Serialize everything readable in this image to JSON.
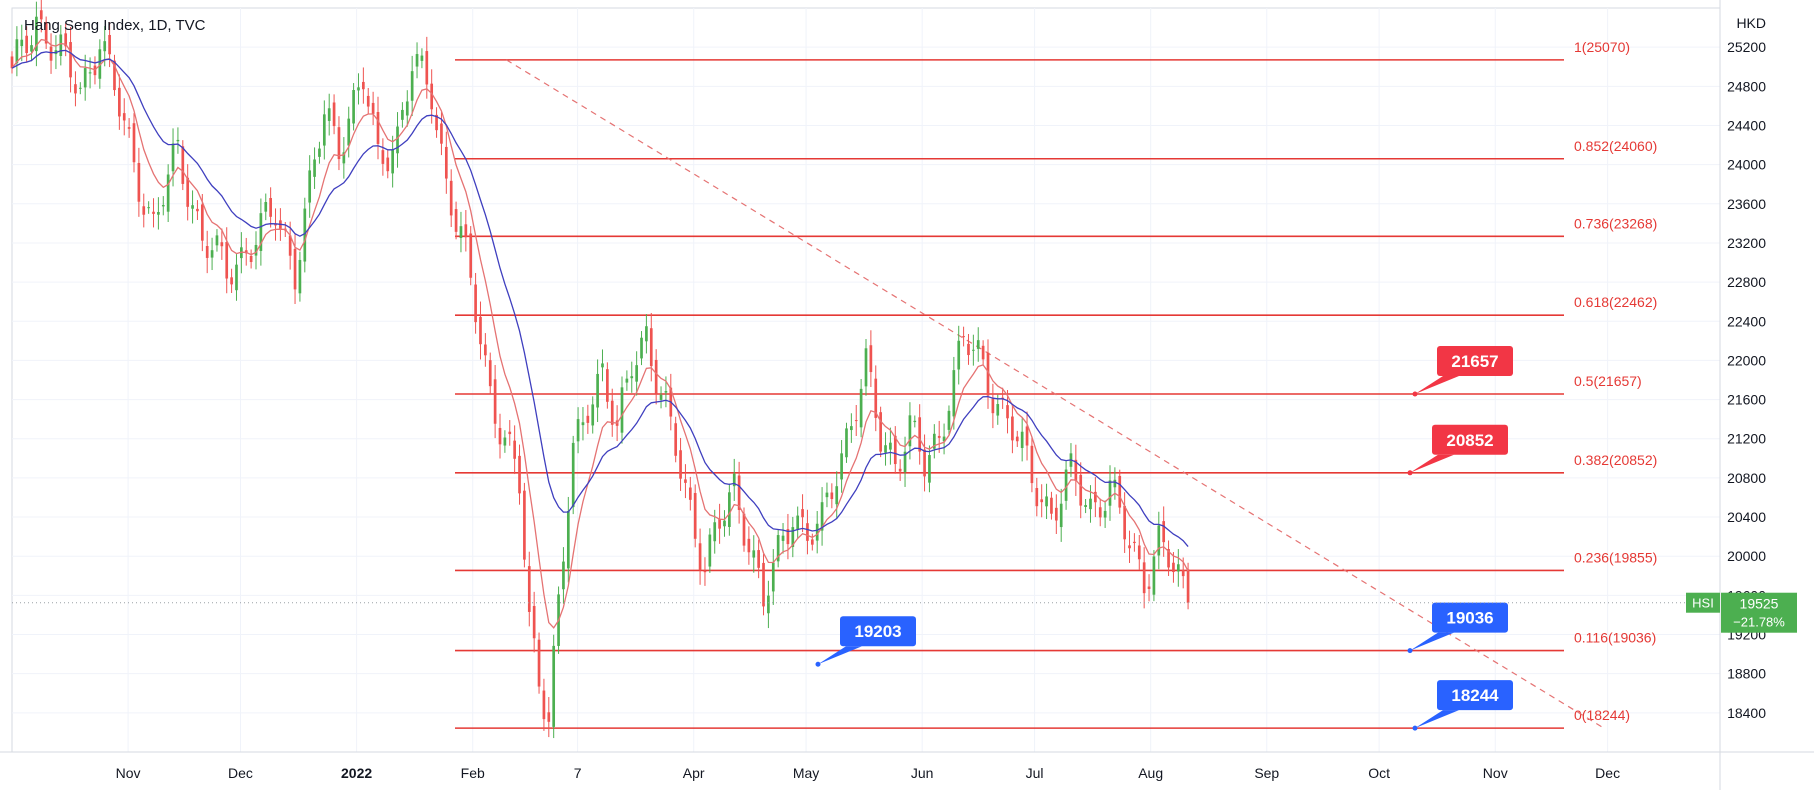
{
  "header": {
    "title": "Hang Seng Index, 1D, TVC"
  },
  "currency": "HKD",
  "colors": {
    "up": "#4caf50",
    "down": "#ef5350",
    "ma_fast": "#e57373",
    "ma_slow": "#3f3fbf",
    "fib_line": "#e53935",
    "callout_red": "#f23645",
    "callout_blue": "#2962ff",
    "last_badge": "#4caf50"
  },
  "chart_data": {
    "type": "candlestick",
    "title": "Hang Seng Index, 1D, TVC",
    "ylabel": "HKD",
    "ylim": [
      18000,
      25600
    ],
    "grid": true,
    "y_ticks": [
      18400,
      18800,
      19200,
      19600,
      20000,
      20400,
      20800,
      21200,
      21600,
      22000,
      22400,
      22800,
      23200,
      23600,
      24000,
      24400,
      24800,
      25200
    ],
    "x_labels": [
      {
        "label": "Nov",
        "bold": false
      },
      {
        "label": "Dec",
        "bold": false
      },
      {
        "label": "2022",
        "bold": true
      },
      {
        "label": "Feb",
        "bold": false
      },
      {
        "label": "7",
        "bold": false
      },
      {
        "label": "Apr",
        "bold": false
      },
      {
        "label": "May",
        "bold": false
      },
      {
        "label": "Jun",
        "bold": false
      },
      {
        "label": "Jul",
        "bold": false
      },
      {
        "label": "Aug",
        "bold": false
      },
      {
        "label": "Sep",
        "bold": false
      },
      {
        "label": "Oct",
        "bold": false
      },
      {
        "label": "Nov",
        "bold": false
      },
      {
        "label": "Dec",
        "bold": false
      }
    ],
    "price_path": [
      [
        0,
        24900
      ],
      [
        5,
        25500
      ],
      [
        10,
        25100
      ],
      [
        14,
        24750
      ],
      [
        18,
        25300
      ],
      [
        24,
        24200
      ],
      [
        29,
        23350
      ],
      [
        34,
        24150
      ],
      [
        39,
        23250
      ],
      [
        44,
        22900
      ],
      [
        49,
        23200
      ],
      [
        54,
        23500
      ],
      [
        58,
        22950
      ],
      [
        64,
        24500
      ],
      [
        67,
        24250
      ],
      [
        72,
        24850
      ],
      [
        75,
        24050
      ],
      [
        79,
        24300
      ],
      [
        82,
        25000
      ],
      [
        86,
        24750
      ],
      [
        89,
        23850
      ],
      [
        92,
        23250
      ],
      [
        95,
        22500
      ],
      [
        98,
        21700
      ],
      [
        101,
        21200
      ],
      [
        104,
        20700
      ],
      [
        106,
        19300
      ],
      [
        108,
        18800
      ],
      [
        110,
        18400
      ],
      [
        112,
        19500
      ],
      [
        115,
        21000
      ],
      [
        118,
        21600
      ],
      [
        121,
        21900
      ],
      [
        124,
        21200
      ],
      [
        127,
        22000
      ],
      [
        130,
        22300
      ],
      [
        133,
        21600
      ],
      [
        136,
        21100
      ],
      [
        139,
        20500
      ],
      [
        142,
        19900
      ],
      [
        145,
        20300
      ],
      [
        148,
        20700
      ],
      [
        151,
        20200
      ],
      [
        154,
        19500
      ],
      [
        157,
        20000
      ],
      [
        160,
        20500
      ],
      [
        163,
        20200
      ],
      [
        166,
        20300
      ],
      [
        169,
        20900
      ],
      [
        172,
        21400
      ],
      [
        175,
        21900
      ],
      [
        178,
        21200
      ],
      [
        181,
        21000
      ],
      [
        184,
        21300
      ],
      [
        187,
        20900
      ],
      [
        190,
        21200
      ],
      [
        192,
        21700
      ],
      [
        195,
        22200
      ],
      [
        198,
        22000
      ],
      [
        201,
        21700
      ],
      [
        205,
        21300
      ],
      [
        209,
        20800
      ],
      [
        213,
        20450
      ],
      [
        217,
        20800
      ],
      [
        221,
        20500
      ],
      [
        225,
        20700
      ],
      [
        229,
        20100
      ],
      [
        232,
        19800
      ],
      [
        235,
        20150
      ],
      [
        238,
        19850
      ],
      [
        241,
        19525
      ]
    ],
    "last_bar_index": 241,
    "x_axis_end_index": 350,
    "series": [
      {
        "name": "Hang Seng Index",
        "type": "candlestick"
      },
      {
        "type": "moving-average",
        "role": "fast",
        "color": "#e57373"
      },
      {
        "type": "moving-average",
        "role": "slow",
        "color": "#3f3fbf"
      }
    ],
    "fibonacci_levels": [
      {
        "ratio": "1",
        "price": 25070,
        "label": "1(25070)"
      },
      {
        "ratio": "0.852",
        "price": 24060,
        "label": "0.852(24060)"
      },
      {
        "ratio": "0.736",
        "price": 23268,
        "label": "0.736(23268)"
      },
      {
        "ratio": "0.618",
        "price": 22462,
        "label": "0.618(22462)"
      },
      {
        "ratio": "0.5",
        "price": 21657,
        "label": "0.5(21657)"
      },
      {
        "ratio": "0.382",
        "price": 20852,
        "label": "0.382(20852)"
      },
      {
        "ratio": "0.236",
        "price": 19855,
        "label": "0.236(19855)"
      },
      {
        "ratio": "0.116",
        "price": 19036,
        "label": "0.116(19036)"
      },
      {
        "ratio": "0",
        "price": 18244,
        "label": "0(18244)"
      }
    ],
    "trendline": {
      "style": "dashed",
      "color": "#e57373",
      "from": {
        "date": "2022-02-10",
        "price": 25070
      },
      "to": {
        "date": "2022-11-30",
        "price": 18244
      }
    },
    "callouts": [
      {
        "text": "21657",
        "color": "red",
        "price": 21657
      },
      {
        "text": "20852",
        "color": "red",
        "price": 20852
      },
      {
        "text": "19203",
        "color": "blue",
        "price": 19203
      },
      {
        "text": "19036",
        "color": "blue",
        "price": 19036
      },
      {
        "text": "18244",
        "color": "blue",
        "price": 18244
      }
    ],
    "last_price": {
      "symbol": "HSI",
      "value": "19525",
      "change": "−21.78%",
      "price": 19525
    }
  }
}
